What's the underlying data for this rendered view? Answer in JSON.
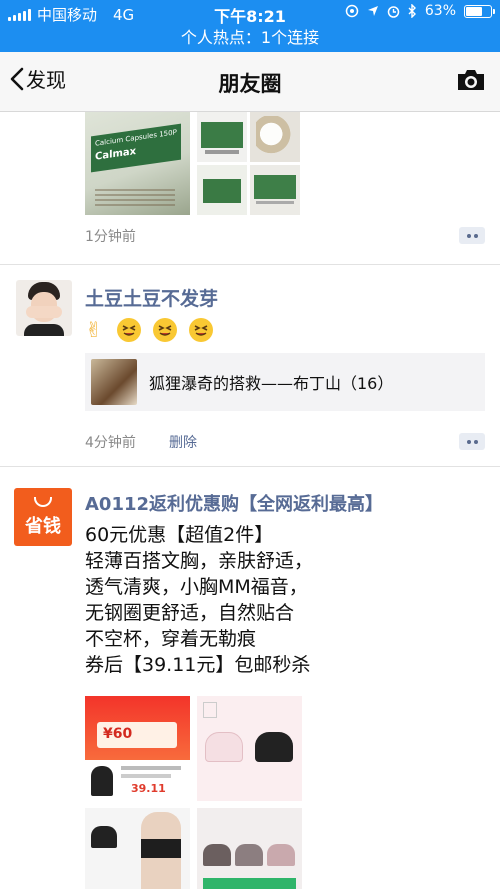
{
  "status_bar": {
    "carrier": "中国移动",
    "network": "4G",
    "time": "下午8:21",
    "battery": "63%",
    "battery_level": 0.63
  },
  "hotspot": "个人热点：1个连接",
  "nav": {
    "back_label": "发现",
    "title": "朋友圈"
  },
  "posts": [
    {
      "time_ago": "1分钟前",
      "photo_texts": [
        "Calcium Capsules 150P",
        "Calmax"
      ]
    },
    {
      "nickname": "土豆土豆不发芽",
      "emoji_text": "✌",
      "share_title": "狐狸瀑奇的搭救——布丁山（16）",
      "time_ago": "4分钟前",
      "delete_label": "删除"
    },
    {
      "nickname": "A0112返利优惠购【全网返利最高】",
      "avatar_label": "省钱",
      "lines": [
        "60元优惠【超值2件】",
        "轻薄百搭文胸，亲肤舒适，",
        "透气清爽，小胸MM福音，",
        "无钢圈更舒适，自然贴合",
        "不空杯，穿着无勒痕",
        "券后【39.11元】包邮秒杀"
      ],
      "coupon_value": "¥60",
      "price": "39.11"
    }
  ],
  "colors": {
    "status_blue": "#1c8ef1",
    "link_blue": "#576b95",
    "brand_orange": "#f25d1d"
  }
}
